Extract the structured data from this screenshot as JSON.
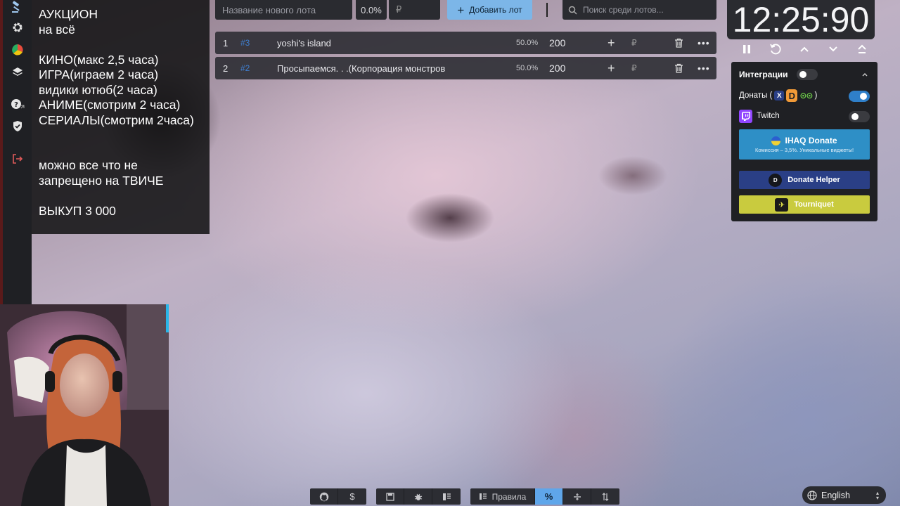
{
  "sidebar": {
    "icons": [
      "gavel-icon",
      "gear-icon",
      "wheel-icon",
      "layers-icon",
      "help-icon",
      "shield-icon",
      "logout-icon"
    ]
  },
  "rules_panel": {
    "lines": [
      "АУКЦИОН",
      "на всё",
      "",
      "КИНО(макс 2,5 часа)",
      "ИГРА(играем 2 часа)",
      "видики ютюб(2 часа)",
      "АНИМЕ(смотрим 2 часа)",
      "СЕРИАЛЫ(смотрим 2часа)",
      "",
      "",
      "можно все что не",
      "запрещено на ТВИЧЕ",
      "",
      "ВЫКУП 3 000"
    ]
  },
  "topbar": {
    "lot_name_placeholder": "Название нового лота",
    "percent": "0.0%",
    "currency": "₽",
    "add_lot_label": "Добавить лот",
    "search_placeholder": "Поиск среди лотов..."
  },
  "lots": [
    {
      "num": "1",
      "id": "#3",
      "title": "yoshi's island",
      "percent": "50.0%",
      "amount": "200",
      "currency": "₽"
    },
    {
      "num": "2",
      "id": "#2",
      "title": "Просыпаемся. . .(Корпорация монстров",
      "percent": "50.0%",
      "amount": "200",
      "currency": "₽"
    }
  ],
  "timer": {
    "display": "12:25:90"
  },
  "integrations": {
    "title": "Интеграции",
    "donations_label": "Донаты (",
    "donations_close": ")",
    "twitch_label": "Twitch",
    "ihaq_label": "IHAQ Donate",
    "ihaq_sub": "Комиссия – 3,5%. Уникальные виджеты!",
    "donate_helper_label": "Donate Helper",
    "tourniquet_label": "Tourniquet",
    "colors": {
      "ihaq": "#2e8fc6",
      "donate_helper": "#2a3f86",
      "tourniquet": "#c9cb3e",
      "twitch": "#9146ff"
    }
  },
  "bottom_toolbar": {
    "rules_label": "Правила",
    "percent_symbol": "%"
  },
  "language": {
    "current": "English"
  }
}
